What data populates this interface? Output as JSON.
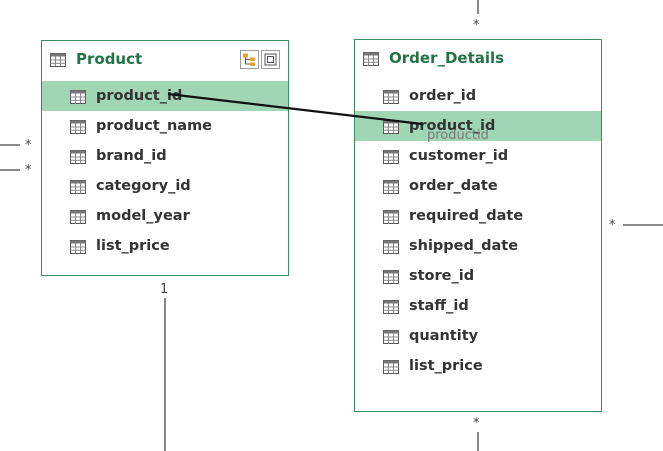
{
  "tables": [
    {
      "name": "Product",
      "fields": [
        "product_id",
        "product_name",
        "brand_id",
        "category_id",
        "model_year",
        "list_price"
      ],
      "selected": "product_id"
    },
    {
      "name": "Order_Details",
      "fields": [
        "order_id",
        "product_id",
        "customer_id",
        "order_date",
        "required_date",
        "shipped_date",
        "store_id",
        "staff_id",
        "quantity",
        "list_price"
      ],
      "selected": "product_id"
    }
  ],
  "cardinality": {
    "many": "*",
    "one": "1"
  },
  "drag_tooltip": "productid",
  "colors": {
    "accent": "#217346",
    "border": "#3d8c61",
    "selected_row": "#a0d6b4",
    "connector": "#444444"
  }
}
